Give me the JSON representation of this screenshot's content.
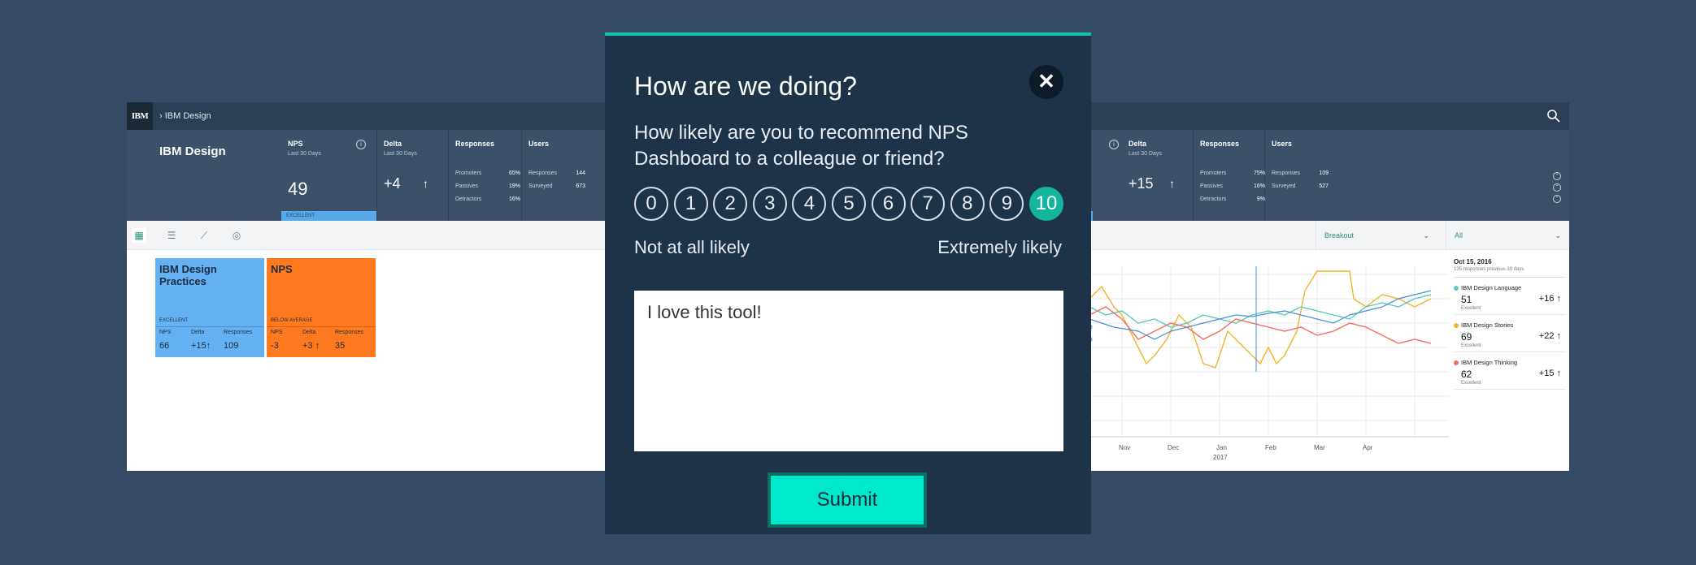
{
  "left_panel": {
    "logo": "IBM",
    "breadcrumb": "›  IBM Design",
    "title": "IBM Design",
    "nps": {
      "label": "NPS",
      "sub": "Last 30 Days",
      "value": "49",
      "status": "EXCELLENT"
    },
    "delta": {
      "label": "Delta",
      "sub": "Last 30 Days",
      "value": "+4",
      "arrow": "↑"
    },
    "responses": {
      "label": "Responses",
      "rows": [
        {
          "k": "Promoters",
          "v": "65%"
        },
        {
          "k": "Passives",
          "v": "19%"
        },
        {
          "k": "Detractors",
          "v": "16%"
        }
      ]
    },
    "users": {
      "label": "Users",
      "rows": [
        {
          "k": "Responses",
          "v": "144"
        },
        {
          "k": "Surveyed",
          "v": "673"
        }
      ]
    },
    "tiles": [
      {
        "name": "IBM Design Practices",
        "status": "EXCELLENT",
        "cols": [
          "NPS",
          "Delta",
          "Responses"
        ],
        "vals": [
          "66",
          "+15↑",
          "109"
        ]
      },
      {
        "name": "NPS",
        "status": "BELOW AVERAGE",
        "cols": [
          "NPS",
          "Delta",
          "Responses"
        ],
        "vals": [
          "-3",
          "+3 ↑",
          "35"
        ]
      }
    ]
  },
  "right_panel": {
    "delta": {
      "label": "Delta",
      "sub": "Last 30 Days",
      "value": "+15",
      "arrow": "↑"
    },
    "responses": {
      "label": "Responses",
      "rows": [
        {
          "k": "Promoters",
          "v": "75%"
        },
        {
          "k": "Passives",
          "v": "16%"
        },
        {
          "k": "Detractors",
          "v": "9%"
        }
      ]
    },
    "users": {
      "label": "Users",
      "rows": [
        {
          "k": "Responses",
          "v": "109"
        },
        {
          "k": "Surveyed",
          "v": "527"
        }
      ]
    },
    "breakout_dropdown": "Breakout",
    "all_dropdown": "All",
    "chart_x_labels": [
      "Nov",
      "Dec",
      "Jan",
      "Feb",
      "Mar",
      "Apr"
    ],
    "chart_year": "2017",
    "side_header": "Oct 15, 2016",
    "side_sub": "135 responses previous 30 days",
    "side_items": [
      {
        "name": "IBM Design Language",
        "value": "51",
        "delta": "+16 ↑",
        "quality": "Excellent",
        "color": "#5bc8c0"
      },
      {
        "name": "IBM Design Stories",
        "value": "69",
        "delta": "+22 ↑",
        "quality": "Excellent",
        "color": "#f0b429"
      },
      {
        "name": "IBM Design Thinking",
        "value": "62",
        "delta": "+15 ↑",
        "quality": "Excellent",
        "color": "#f26b5b"
      }
    ]
  },
  "modal": {
    "title": "How are we doing?",
    "close_glyph": "✕",
    "question": "How likely are you to recommend NPS Dashboard to a colleague or friend?",
    "scale": [
      "0",
      "1",
      "2",
      "3",
      "4",
      "5",
      "6",
      "7",
      "8",
      "9",
      "10"
    ],
    "selected": "10",
    "low_label": "Not at all likely",
    "high_label": "Extremely likely",
    "feedback_value": "I love this tool!",
    "submit_label": "Submit",
    "accent_color": "#14c3a6"
  }
}
